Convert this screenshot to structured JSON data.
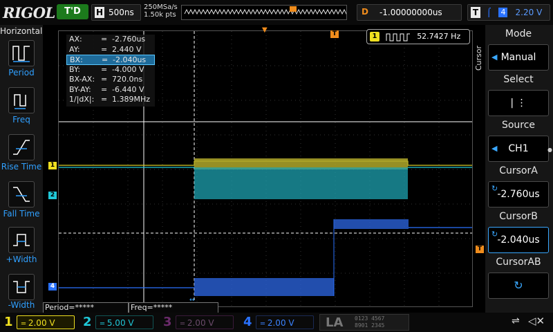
{
  "top": {
    "brand": "RIGOL",
    "run_state": "T'D",
    "timebase_label": "H",
    "timebase": "500ns",
    "sample_rate": "250MSa/s",
    "mem_depth": "1.50k pts",
    "delay_label": "D",
    "delay": "-1.00000000us",
    "trigger_label": "T",
    "trigger_source": "4",
    "trigger_level": "2.20 V"
  },
  "left_panel": {
    "title": "Horizontal",
    "items": [
      {
        "label": "Period"
      },
      {
        "label": "Freq"
      },
      {
        "label": "Rise Time"
      },
      {
        "label": "Fall Time"
      },
      {
        "label": "+Width"
      },
      {
        "label": "-Width"
      }
    ]
  },
  "cursor_readout": {
    "rows": [
      {
        "key": "AX:",
        "eq": "=",
        "val": "-2.760us"
      },
      {
        "key": "AY:",
        "eq": "=",
        "val": "2.440 V"
      },
      {
        "key": "BX:",
        "eq": "=",
        "val": "-2.040us"
      },
      {
        "key": "BY:",
        "eq": "=",
        "val": "-4.000 V"
      },
      {
        "key": "BX-AX:",
        "eq": "=",
        "val": "720.0ns"
      },
      {
        "key": "BY-AY:",
        "eq": "=",
        "val": "-6.440 V"
      },
      {
        "key": "1/|dX|:",
        "eq": "=",
        "val": "1.389MHz"
      }
    ]
  },
  "frequency_counter": {
    "channel": "1",
    "value": "52.7427 Hz"
  },
  "markers": {
    "ch1": "1",
    "ch2": "2",
    "ch4": "4",
    "trig": "T"
  },
  "right_panel": {
    "menu_title": "Cursor",
    "mode_label": "Mode",
    "mode_value": "Manual",
    "select_label": "Select",
    "select_value": "|   ⋮",
    "source_label": "Source",
    "source_value": "CH1",
    "cursor_a_label": "CursorA",
    "cursor_a_value": "-2.760us",
    "cursor_b_label": "CursorB",
    "cursor_b_value": "-2.040us",
    "cursor_ab_label": "CursorAB"
  },
  "measurements": {
    "period": "Period=*****",
    "freq": "Freq=*****"
  },
  "channels": [
    {
      "num": "1",
      "scale": "2.00 V",
      "color": "#f0e020"
    },
    {
      "num": "2",
      "scale": "5.00 V",
      "color": "#20c8d8"
    },
    {
      "num": "3",
      "scale": "2.00 V",
      "color": "#c03cc0"
    },
    {
      "num": "4",
      "scale": "2.00 V",
      "color": "#2a72ff"
    }
  ],
  "la": {
    "label": "LA",
    "row1": "0123 4567",
    "row2": "8901 2345"
  },
  "colors": {
    "ch1": "#f0e020",
    "ch2": "#20c8d8",
    "ch3": "#c03cc0",
    "ch4": "#2a72ff",
    "trigger": "#f08c1c"
  }
}
